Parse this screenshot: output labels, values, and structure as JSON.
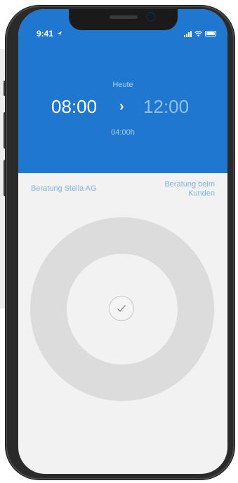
{
  "status_bar": {
    "time": "9:41"
  },
  "header": {
    "day_label": "Heute",
    "start_time": "08:00",
    "arrow": "›",
    "end_time": "12:00",
    "duration": "04:00h"
  },
  "labels": {
    "left": "Beratung Stella AG",
    "right": "Beratung beim Kunden"
  },
  "colors": {
    "header_bg": "#1f77d0",
    "label": "#7fb3e6",
    "ring": "#dcdcdc"
  },
  "icons": [
    "location-arrow-icon",
    "signal-icon",
    "wifi-icon",
    "battery-icon",
    "check-icon"
  ]
}
